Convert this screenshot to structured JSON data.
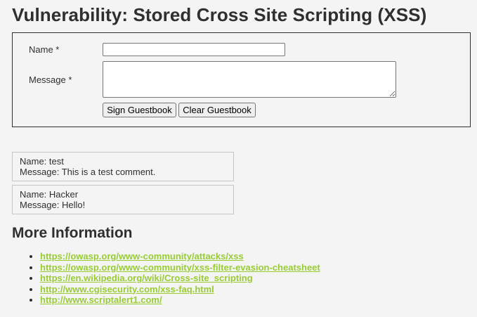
{
  "page": {
    "title": "Vulnerability: Stored Cross Site Scripting (XSS)"
  },
  "form": {
    "name_label": "Name *",
    "name_value": "",
    "message_label": "Message *",
    "message_value": "",
    "sign_button": "Sign Guestbook",
    "clear_button": "Clear Guestbook"
  },
  "entries": [
    {
      "name_line": "Name: test",
      "message_line": "Message: This is a test comment."
    },
    {
      "name_line": "Name: Hacker",
      "message_line": "Message: Hello!"
    }
  ],
  "more_info": {
    "title": "More Information",
    "links": [
      "https://owasp.org/www-community/attacks/xss",
      "https://owasp.org/www-community/xss-filter-evasion-cheatsheet",
      "https://en.wikipedia.org/wiki/Cross-site_scripting",
      "http://www.cgisecurity.com/xss-faq.html",
      "http://www.scriptalert1.com/"
    ]
  },
  "colors": {
    "link": "#99cc33",
    "text": "#2f2f2f",
    "background": "#f4f4f4"
  }
}
